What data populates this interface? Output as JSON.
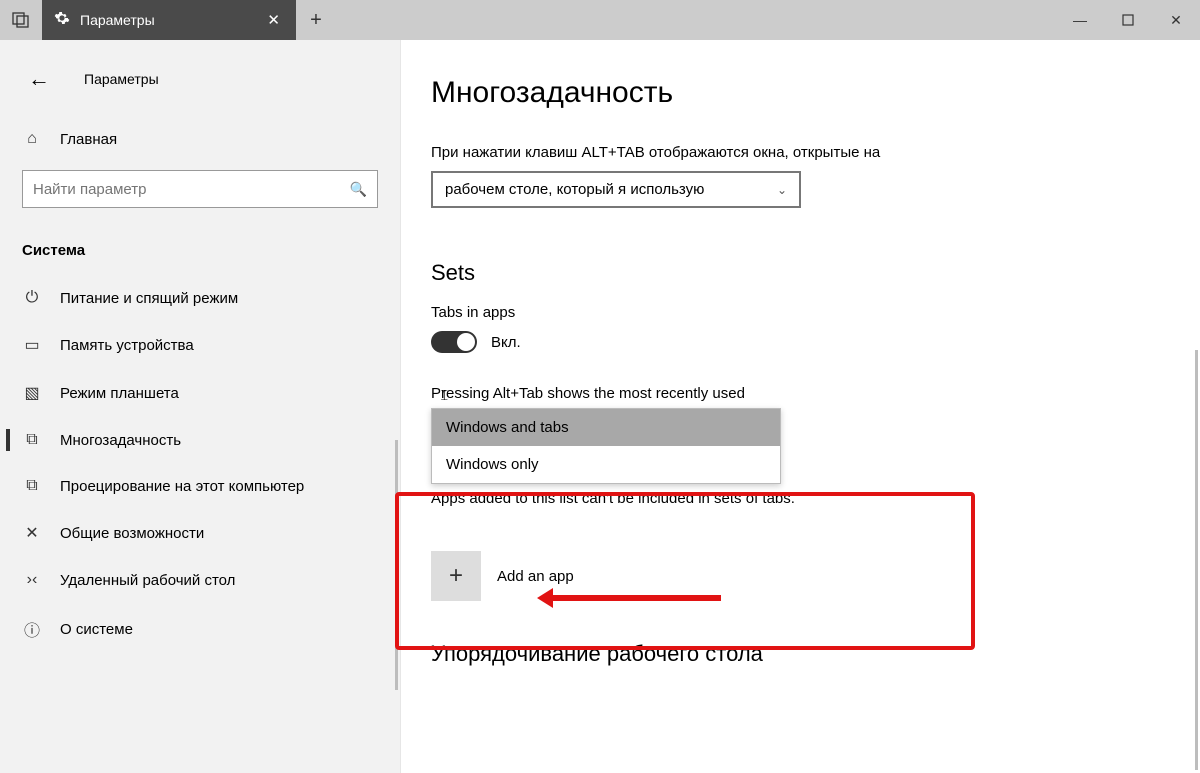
{
  "tab": {
    "title": "Параметры"
  },
  "window_controls": {
    "minimize": "—",
    "maximize": "▢",
    "close": "✕"
  },
  "sidebar": {
    "breadcrumb": "Параметры",
    "home": "Главная",
    "search_placeholder": "Найти параметр",
    "category": "Система",
    "items": [
      {
        "icon": "⏻",
        "label": "Питание и спящий режим"
      },
      {
        "icon": "▭",
        "label": "Память устройства"
      },
      {
        "icon": "▧",
        "label": "Режим планшета"
      },
      {
        "icon": "⧉",
        "label": "Многозадачность",
        "selected": true
      },
      {
        "icon": "⧉",
        "label": "Проецирование на этот компьютер"
      },
      {
        "icon": "✕",
        "label": "Общие возможности"
      },
      {
        "icon": "›‹",
        "label": "Удаленный рабочий стол"
      },
      {
        "icon": "ⓘ",
        "label": "О системе"
      }
    ]
  },
  "main": {
    "title": "Многозадачность",
    "alt_tab_desc": "При нажатии клавиш ALT+TAB отображаются окна, открытые на",
    "alt_tab_value": "рабочем столе, который я использую",
    "sets_heading": "Sets",
    "tabs_in_apps_label": "Tabs in apps",
    "toggle_on": "Вкл.",
    "alt_tab_shows": "Pressing Alt+Tab shows the most recently used",
    "dd_option1": "Windows and tabs",
    "dd_option2": "Windows only",
    "excluded_line": "Apps added to this list can't be included in sets of tabs.",
    "add_app": "Add an app",
    "snap_heading": "Упорядочивание рабочего стола"
  }
}
